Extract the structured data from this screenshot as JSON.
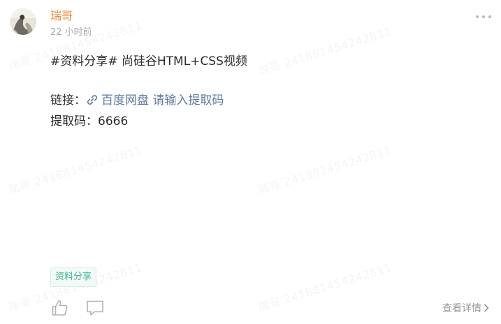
{
  "post": {
    "author": {
      "name": "瑞哥"
    },
    "time": "22 小时前",
    "content": {
      "title": "#资料分享# 尚硅谷HTML+CSS视频",
      "link_label": "链接：",
      "link_text": "百度网盘 请输入提取码",
      "code_label": "提取码：",
      "code_value": "6666"
    },
    "tag": "资料分享",
    "detail_link": "查看详情"
  },
  "watermark": "瑞哥 2418814542428​11",
  "icons": {
    "more": "more-dots-icon",
    "link": "link-icon",
    "like": "thumbs-up-icon",
    "comment": "comment-icon",
    "detail_arrow": "chevron-right-icon"
  },
  "colors": {
    "author": "#f08a3c",
    "link": "#5f7ba1",
    "tag_text": "#3fb68a",
    "tag_bg": "#f1faf6"
  }
}
